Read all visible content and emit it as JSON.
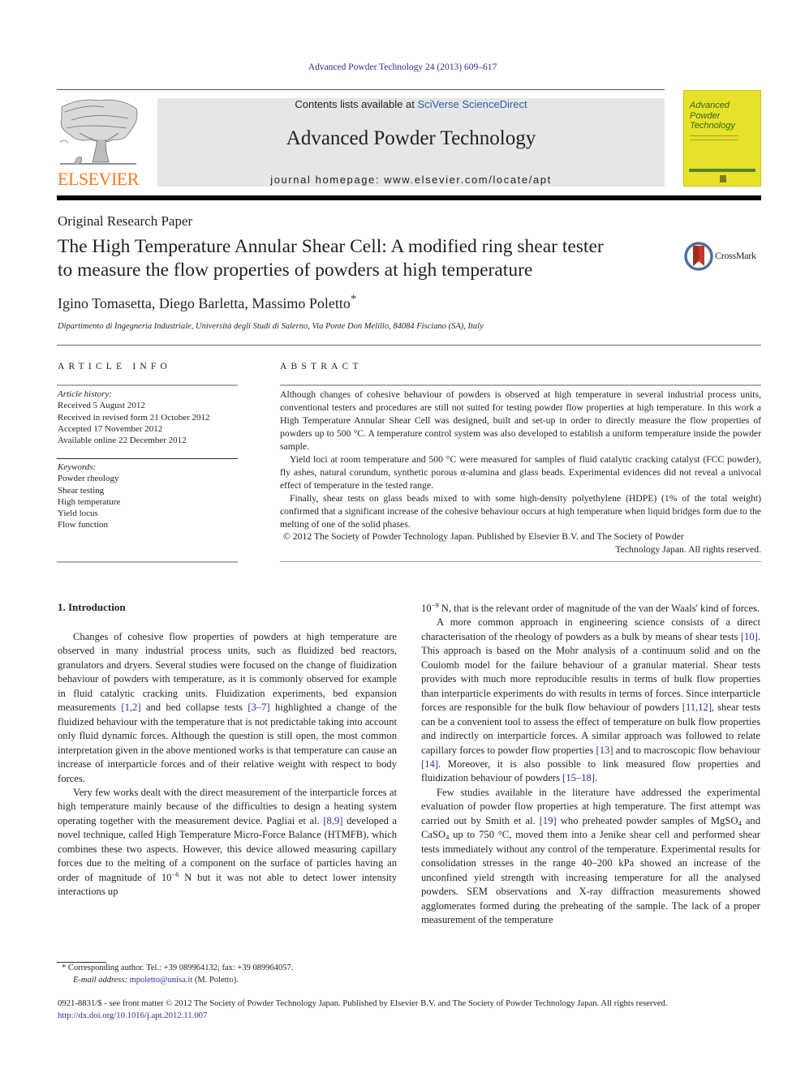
{
  "header": {
    "citation": "Advanced Powder Technology 24 (2013) 609–617",
    "contents_prefix": "Contents lists available at ",
    "contents_link": "SciVerse ScienceDirect",
    "journal_name": "Advanced Powder Technology",
    "homepage": "journal homepage: www.elsevier.com/locate/apt",
    "publisher_logo_text": "ELSEVIER",
    "cover_title_lines": [
      "Advanced",
      "Powder",
      "Technology"
    ],
    "crossmark_label": "CrossMark"
  },
  "article": {
    "type": "Original Research Paper",
    "title_line1": "The High Temperature Annular Shear Cell: A modified ring shear tester",
    "title_line2": "to measure the flow properties of powders at high temperature",
    "authors": "Igino Tomasetta, Diego Barletta, Massimo Poletto",
    "corresponding_mark": "*",
    "affiliation": "Dipartimento di Ingegneria Industriale, Università degli Studi di Salerno, Via Ponte Don Melillo, 84084 Fisciano (SA), Italy"
  },
  "article_info": {
    "heading": "ARTICLE INFO",
    "history_label": "Article history:",
    "history": [
      "Received 5 August 2012",
      "Received in revised form 21 October 2012",
      "Accepted 17 November 2012",
      "Available online 22 December 2012"
    ],
    "keywords_label": "Keywords:",
    "keywords": [
      "Powder rheology",
      "Shear testing",
      "High temperature",
      "Yield locus",
      "Flow function"
    ]
  },
  "abstract": {
    "heading": "ABSTRACT",
    "paragraphs": [
      "Although changes of cohesive behaviour of powders is observed at high temperature in several industrial process units, conventional testers and procedures are still not suited for testing powder flow properties at high temperature. In this work a High Temperature Annular Shear Cell was designed, built and set-up in order to directly measure the flow properties of powders up to 500 °C. A temperature control system was also developed to establish a uniform temperature inside the powder sample.",
      "Yield loci at room temperature and 500 °C were measured for samples of fluid catalytic cracking catalyst (FCC powder), fly ashes, natural corundum, synthetic porous α-alumina and glass beads. Experimental evidences did not reveal a univocal effect of temperature in the tested range.",
      "Finally, shear tests on glass beads mixed to with some high-density polyethylene (HDPE) (1% of the total weight) confirmed that a significant increase of the cohesive behaviour occurs at high temperature when liquid bridges form due to the melting of one of the solid phases."
    ],
    "copyright_line1": "© 2012 The Society of Powder Technology Japan. Published by Elsevier B.V. and The Society of Powder",
    "copyright_line2": "Technology Japan. All rights reserved."
  },
  "body": {
    "section_heading": "1. Introduction",
    "left": {
      "p1_a": "Changes of cohesive flow properties of powders at high temperature are observed in many industrial process units, such as fluidized bed reactors, granulators and dryers. Several studies were focused on the change of fluidization behaviour of powders with temperature, as it is commonly observed for example in fluid catalytic cracking units. Fluidization experiments, bed expansion measurements ",
      "p1_ref1": "[1,2]",
      "p1_b": " and bed collapse tests ",
      "p1_ref2": "[3–7]",
      "p1_c": " highlighted a change of the fluidized behaviour with the temperature that is not predictable taking into account only fluid dynamic forces. Although the question is still open, the most common interpretation given in the above mentioned works is that temperature can cause an increase of interparticle forces and of their relative weight with respect to body forces.",
      "p2_a": "Very few works dealt with the direct measurement of the interparticle forces at high temperature mainly because of the difficulties to design a heating system operating together with the measurement device. Pagliai et al. ",
      "p2_ref1": "[8,9]",
      "p2_b": " developed a novel technique, called High Temperature Micro-Force Balance (HTMFB), which combines these two aspects. However, this device allowed measuring capillary forces due to the melting of a component on the surface of particles having an order of magnitude of 10",
      "p2_exp": "−6",
      "p2_c": " N but it was not able to detect lower intensity interactions up"
    },
    "right": {
      "p0_base": "10",
      "p0_exp": "−9",
      "p0_a": " N, that is the relevant order of magnitude of the van der Waals' kind of forces.",
      "p1_a": "A more common approach in engineering science consists of a direct characterisation of the rheology of powders as a bulk by means of shear tests ",
      "p1_ref1": "[10]",
      "p1_b": ". This approach is based on the Mohr analysis of a continuum solid and on the Coulomb model for the failure behaviour of a granular material. Shear tests provides with much more reproducible results in terms of bulk flow properties than interparticle experiments do with results in terms of forces. Since interparticle forces are responsible for the bulk flow behaviour of powders ",
      "p1_ref2": "[11,12]",
      "p1_c": ", shear tests can be a convenient tool to assess the effect of temperature on bulk flow properties and indirectly on interparticle forces. A similar approach was followed to relate capillary forces to powder flow properties ",
      "p1_ref3": "[13]",
      "p1_d": " and to macroscopic flow behaviour ",
      "p1_ref4": "[14]",
      "p1_e": ". Moreover, it is also possible to link measured flow properties and fluidization behaviour of powders ",
      "p1_ref5": "[15–18]",
      "p1_f": ".",
      "p2_a": "Few studies available in the literature have addressed the experimental evaluation of powder flow properties at high temperature. The first attempt was carried out by Smith et al. ",
      "p2_ref1": "[19]",
      "p2_b": " who preheated powder samples of MgSO",
      "p2_sub1": "4",
      "p2_c": " and CaSO",
      "p2_sub2": "4",
      "p2_d": " up to 750 °C, moved them into a Jenike shear cell and performed shear tests immediately without any control of the temperature. Experimental results for consolidation stresses in the range 40–200 kPa showed an increase of the unconfined yield strength with increasing temperature for all the analysed powders. SEM observations and X-ray diffraction measurements showed agglomerates formed during the preheating of the sample. The lack of a proper measurement of the temperature"
    }
  },
  "footnote": {
    "mark": "*",
    "line1": " Corresponding author. Tel.: +39 089964132; fax: +39 089964057.",
    "email_label": "E-mail address: ",
    "email": "mpoletto@unisa.it",
    "email_suffix": " (M. Poletto)."
  },
  "bottom": {
    "issn_line": "0921-8831/$ - see front matter © 2012 The Society of Powder Technology Japan. Published by Elsevier B.V. and The Society of Powder Technology Japan. All rights reserved.",
    "doi": "http://dx.doi.org/10.1016/j.apt.2012.11.007"
  },
  "colors": {
    "link": "#2e3192",
    "elsevier_orange": "#f47b20",
    "cover_yellow": "#e8e12a",
    "masthead_gray": "#e6e6e6"
  }
}
